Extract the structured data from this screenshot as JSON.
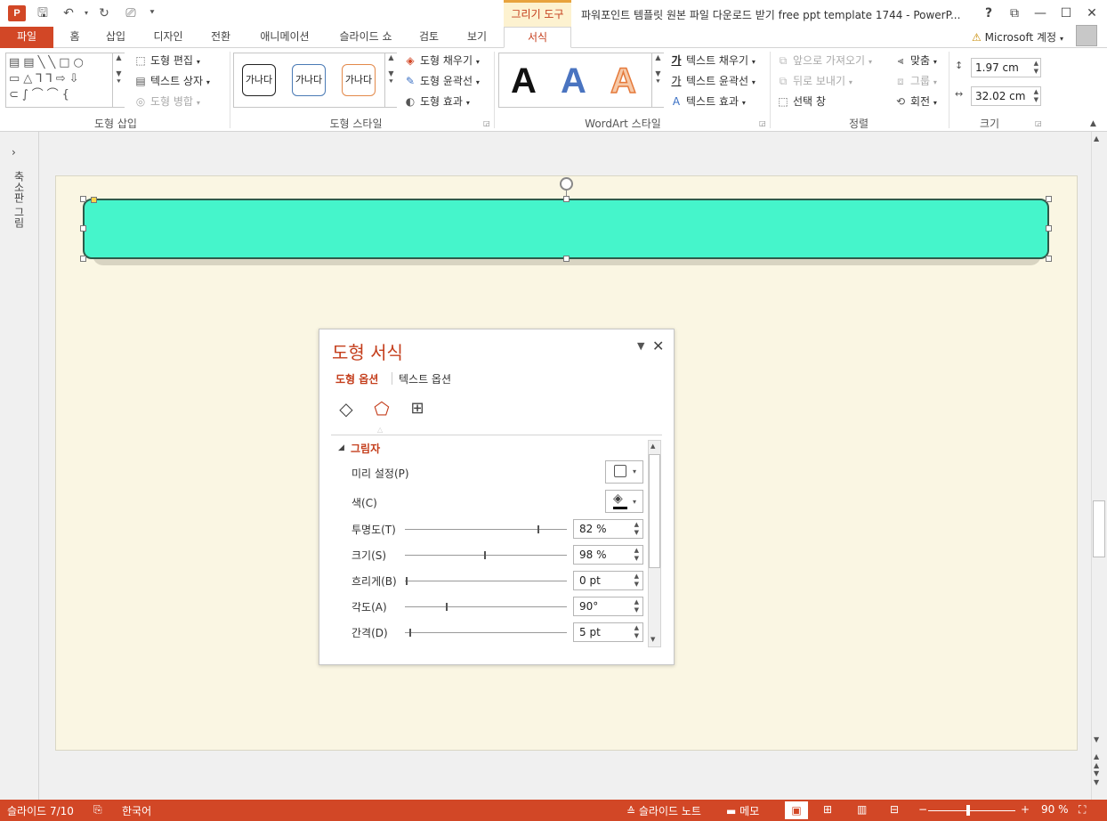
{
  "window": {
    "title": "파워포인트 템플릿 원본 파일 다운로드 받기 free ppt template 1744 - PowerP...",
    "context_tab": "그리기 도구",
    "help": "?",
    "app_logo": "P"
  },
  "tabs": [
    "파일",
    "홈",
    "삽입",
    "디자인",
    "전환",
    "애니메이션",
    "슬라이드 쇼",
    "검토",
    "보기",
    "서식"
  ],
  "account": {
    "label": "Microsoft 계정",
    "warning_icon": "warning-icon"
  },
  "ribbon": {
    "insert_shapes": {
      "label": "도형 삽입",
      "edit_shape": "도형 편집",
      "text_box": "텍스트 상자",
      "merge_shapes": "도형 병합"
    },
    "shape_styles": {
      "label": "도형 스타일",
      "swatches": [
        "가나다",
        "가나다",
        "가나다"
      ],
      "fill": "도형 채우기",
      "outline": "도형 윤곽선",
      "effects": "도형 효과"
    },
    "wordart": {
      "label": "WordArt 스타일",
      "letters": [
        "A",
        "A",
        "A"
      ],
      "text_fill": "텍스트 채우기",
      "text_outline": "텍스트 윤곽선",
      "text_effects": "텍스트 효과",
      "fill_glyph": "가",
      "outline_glyph": "가"
    },
    "arrange": {
      "label": "정렬",
      "bring_forward": "앞으로 가져오기",
      "send_backward": "뒤로 보내기",
      "selection_pane": "선택 창",
      "align": "맞춤",
      "group": "그룹",
      "rotate": "회전"
    },
    "size": {
      "label": "크기",
      "height": "1.97 cm",
      "width": "32.02 cm"
    }
  },
  "sidebar": {
    "label": "축소판 그림"
  },
  "format_pane": {
    "title": "도형 서식",
    "tab_shape": "도형 옵션",
    "tab_text": "텍스트 옵션",
    "section": "그림자",
    "presets": "미리 설정(P)",
    "color": "색(C)",
    "properties": [
      {
        "label": "투명도(T)",
        "value": "82 %",
        "slider": 0.82
      },
      {
        "label": "크기(S)",
        "value": "98 %",
        "slider": 0.49
      },
      {
        "label": "흐리게(B)",
        "value": "0 pt",
        "slider": 0.0
      },
      {
        "label": "각도(A)",
        "value": "90°",
        "slider": 0.25
      },
      {
        "label": "간격(D)",
        "value": "5 pt",
        "slider": 0.02
      }
    ]
  },
  "colors": {
    "accent": "#d24726",
    "shape_fill": "#45f5cb",
    "slide_bg": "#faf6e3"
  },
  "statusbar": {
    "slide": "슬라이드 7/10",
    "language": "한국어",
    "notes": "슬라이드 노트",
    "comments": "메모",
    "zoom": "90 %",
    "zoom_level": 0.9
  }
}
